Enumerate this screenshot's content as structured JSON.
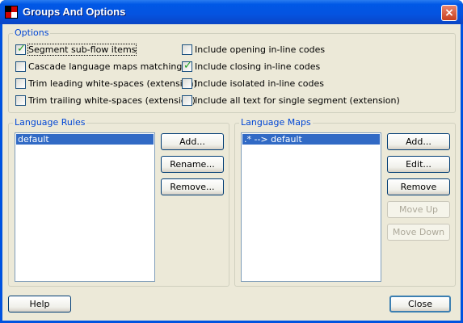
{
  "window": {
    "title": "Groups And Options",
    "close_icon": "×"
  },
  "options": {
    "label": "Options",
    "checkboxes_left": [
      {
        "label": "Segment sub-flow items",
        "checked": true
      },
      {
        "label": "Cascade language maps matching",
        "checked": false
      },
      {
        "label": "Trim leading white-spaces (extension)",
        "checked": false
      },
      {
        "label": "Trim trailing white-spaces (extension)",
        "checked": false
      }
    ],
    "checkboxes_right": [
      {
        "label": "Include opening in-line codes",
        "checked": false
      },
      {
        "label": "Include closing in-line codes",
        "checked": true
      },
      {
        "label": "Include isolated in-line codes",
        "checked": false
      },
      {
        "label": "Include all text for single segment (extension)",
        "checked": false
      }
    ]
  },
  "language_rules": {
    "label": "Language Rules",
    "items": [
      "default"
    ],
    "buttons": {
      "add": "Add...",
      "rename": "Rename...",
      "remove": "Remove..."
    }
  },
  "language_maps": {
    "label": "Language Maps",
    "items": [
      ".* --> default"
    ],
    "buttons": {
      "add": "Add...",
      "edit": "Edit...",
      "remove": "Remove",
      "move_up": "Move Up",
      "move_down": "Move Down"
    }
  },
  "footer": {
    "help": "Help",
    "close": "Close"
  },
  "colors": {
    "accent": "#0046d5",
    "selection": "#316ac5",
    "face": "#ece9d8"
  }
}
